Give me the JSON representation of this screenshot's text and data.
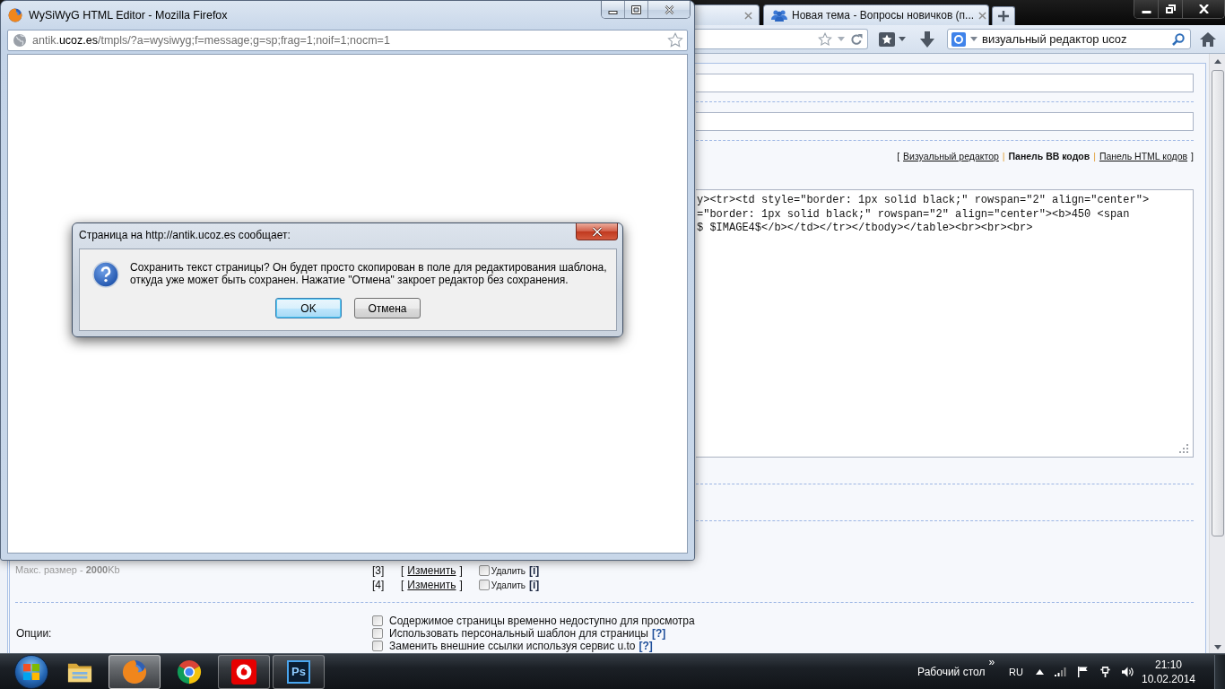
{
  "browser": {
    "tabs": [
      {
        "title": "Новая тема - Вопросы новичков (п..."
      }
    ],
    "search": {
      "value": "визуальный редактор ucoz"
    }
  },
  "page": {
    "mode_bar": {
      "open": "[",
      "modes": [
        {
          "label": "Визуальный редактор",
          "selected": false
        },
        {
          "label": "Панель BB кодов",
          "selected": true
        },
        {
          "label": "Панель HTML кодов",
          "selected": false
        }
      ],
      "separators": [
        "|",
        "|"
      ],
      "close": "]"
    },
    "code_lines": [
      "y><tr><td style=\"border: 1px solid black;\" rowspan=\"2\" align=\"center\">",
      "=\"border: 1px solid black;\" rowspan=\"2\" align=\"center\"><b>450 <span",
      "$ $IMAGE4$</b></td></tr></tbody></table><br><br><br>"
    ],
    "max_size": "Макс. размер - **2000**Kb",
    "image_rows": [
      {
        "index": "[3]",
        "edit_open": "[",
        "edit": "Изменить",
        "edit_close": "]",
        "checked": false,
        "delete": "Удалить",
        "info": "[i]"
      },
      {
        "index": "[4]",
        "edit_open": "[",
        "edit": "Изменить",
        "edit_close": "]",
        "checked": false,
        "delete": "Удалить",
        "info": "[i]"
      }
    ],
    "options_label": "Опции:",
    "options": [
      {
        "label": "Содержимое страницы временно недоступно для просмотра",
        "checked": false
      },
      {
        "label": "Использовать персональный шаблон для страницы",
        "help": "[?]",
        "checked": false
      },
      {
        "label": "Заменить внешние ссылки используя сервис u.to",
        "help": "[?]",
        "checked": false
      }
    ]
  },
  "popup": {
    "title": "WySiWyG HTML Editor - Mozilla Firefox",
    "url": {
      "subdomain": "antik.",
      "domain": "ucoz.es",
      "path": "/tmpls/?a=wysiwyg;f=message;g=sp;frag=1;noif=1;nocm=1"
    }
  },
  "dialog": {
    "title": "Страница на http://antik.ucoz.es сообщает:",
    "message": "Сохранить текст страницы? Он будет просто скопирован в поле для редактирования шаблона, откуда уже может быть сохранен. Нажатие \"Отмена\" закроет редактор без сохранения.",
    "buttons": [
      {
        "label": "OK",
        "selected": true
      },
      {
        "label": "Отмена",
        "selected": false
      }
    ]
  },
  "taskbar": {
    "apps": [
      {
        "kind": "explorer",
        "running": false,
        "active": false
      },
      {
        "kind": "firefox",
        "running": true,
        "active": true
      },
      {
        "kind": "chrome",
        "running": false,
        "active": false
      },
      {
        "kind": "vodafone",
        "running": true,
        "active": false
      },
      {
        "kind": "photoshop",
        "running": true,
        "active": false,
        "logo": "Ps"
      }
    ],
    "tray": {
      "toolbar": "Рабочий стол",
      "chevron": "»",
      "language": "RU",
      "time": "21:10",
      "date": "10.02.2014"
    }
  }
}
